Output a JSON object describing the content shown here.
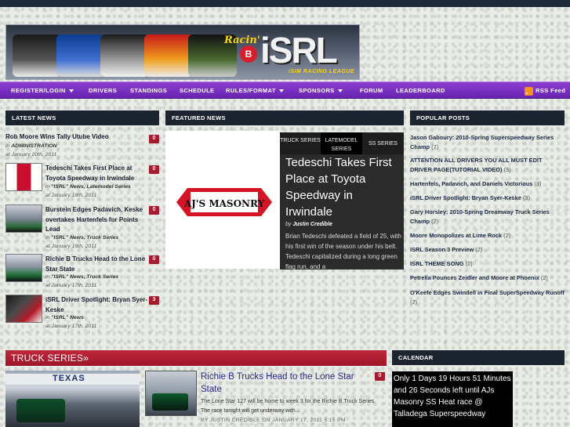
{
  "banner": {
    "logo_small": "Racin'",
    "logo_b": "B",
    "logo_main": "iSRL",
    "logo_sub": "iSIM RACING LEAGUE"
  },
  "nav": {
    "items": [
      "REGISTER/LOGIN",
      "DRIVERS",
      "STANDINGS",
      "SCHEDULE",
      "RULES/FORMAT",
      "SPONSORS",
      "FORUM",
      "LEADERBOARD"
    ],
    "rss": "RSS Feed"
  },
  "latest_news": {
    "heading": "LATEST NEWS",
    "items": [
      {
        "title": "Rob Moore Wins Tally Utube Video",
        "in_label": "in",
        "category": "ADMINISTRATION",
        "date": "at January 20th, 2011",
        "comments": "0"
      },
      {
        "title": "Tedeschi Takes First Place at Toyota Speedway in Irwindale",
        "in_label": "in",
        "category": "\"ISRL\" News, Latemodel Series",
        "date": "at January 19th, 2011",
        "comments": "0"
      },
      {
        "title": "Burstein Edges Padavich, Keske overtakes Hartenfels for Points Lead",
        "in_label": "in",
        "category": "\"ISRL\" News, Truck Series",
        "date": "at January 19th, 2011",
        "comments": "0"
      },
      {
        "title": "Richie B Trucks Head to the Lone Star State",
        "in_label": "in",
        "category": "\"ISRL\" News, Truck Series",
        "date": "at January 17th, 2011",
        "comments": "0"
      },
      {
        "title": "iSRL Driver Spotlight: Bryan Syer-Keske",
        "in_label": "in",
        "category": "\"ISRL\" News",
        "date": "at January 17th, 2011",
        "comments": "3"
      }
    ]
  },
  "featured": {
    "heading": "FEATURED NEWS",
    "sponsor_logo": "AJ'S MASONRY",
    "tabs": [
      "TRUCK SERIES",
      "LATEMODEL SERIES",
      "SS SERIES"
    ],
    "title": "Tedeschi Takes First Place at Toyota Speedway in Irwindale",
    "by_label": "by",
    "author": "Justin Credible",
    "excerpt": "Brian Tedeschi defeated a field of 25, with his first win of the season under his belt. Tedeschi capitalized during a long green flag run, and a"
  },
  "popular": {
    "heading": "POPULAR POSTS",
    "items": [
      {
        "title": "Jason Gaboury: 2010-Spring Superspeedway Series Champ",
        "count": "(7)"
      },
      {
        "title": "ATTENTION ALL DRIVERS YOU ALL MUST EDIT DRIVER PAGE(TUTORIAL VIDEO)",
        "count": "(3)"
      },
      {
        "title": "Hartenfels, Padavich, and Daniels Victorious",
        "count": "(3)"
      },
      {
        "title": "iSRL Driver Spotlight: Bryan Syer-Keske",
        "count": "(3)"
      },
      {
        "title": "Gary Horsley: 2010-Spring Dreamway Truck Series Champ",
        "count": "(2)"
      },
      {
        "title": "Moore Monopolizes at Lime Rock",
        "count": "(2)"
      },
      {
        "title": "iSRL Season 3 Preview",
        "count": "(2)"
      },
      {
        "title": "ISRL THEME SONG",
        "count": "(2)"
      },
      {
        "title": "Petrella Pounces Zeidler and Moore at Phoenix",
        "count": "(2)"
      },
      {
        "title": "O'Keefe Edges Swindell in Final SuperSpeedway Runoff",
        "count": "(2)"
      }
    ]
  },
  "truck_series": {
    "heading": "TRUCK SERIES»",
    "img_text": "TEXAS",
    "title": "Richie B Trucks Head to the Lone Star State",
    "comments": "0",
    "excerpt": "The Lone Star 127 will be home to week 3 for the Richie B Truck Series The race tonight will get underway with...",
    "meta": "BY JUSTIN CREDIBLE ON JANUARY 17, 2011 5:15 PM"
  },
  "calendar": {
    "heading": "CALENDAR",
    "countdown": "Only 1 Days 19 Hours 51 Minutes and 26 Seconds left until AJs Masonry SS Heat race @ Talladega Superspeedway"
  },
  "colors": {
    "nav_purple": "#7a2fc4",
    "section_dark": "#1c2430",
    "badge_red": "#a61c2f",
    "truck_head_red": "#b31f33"
  }
}
